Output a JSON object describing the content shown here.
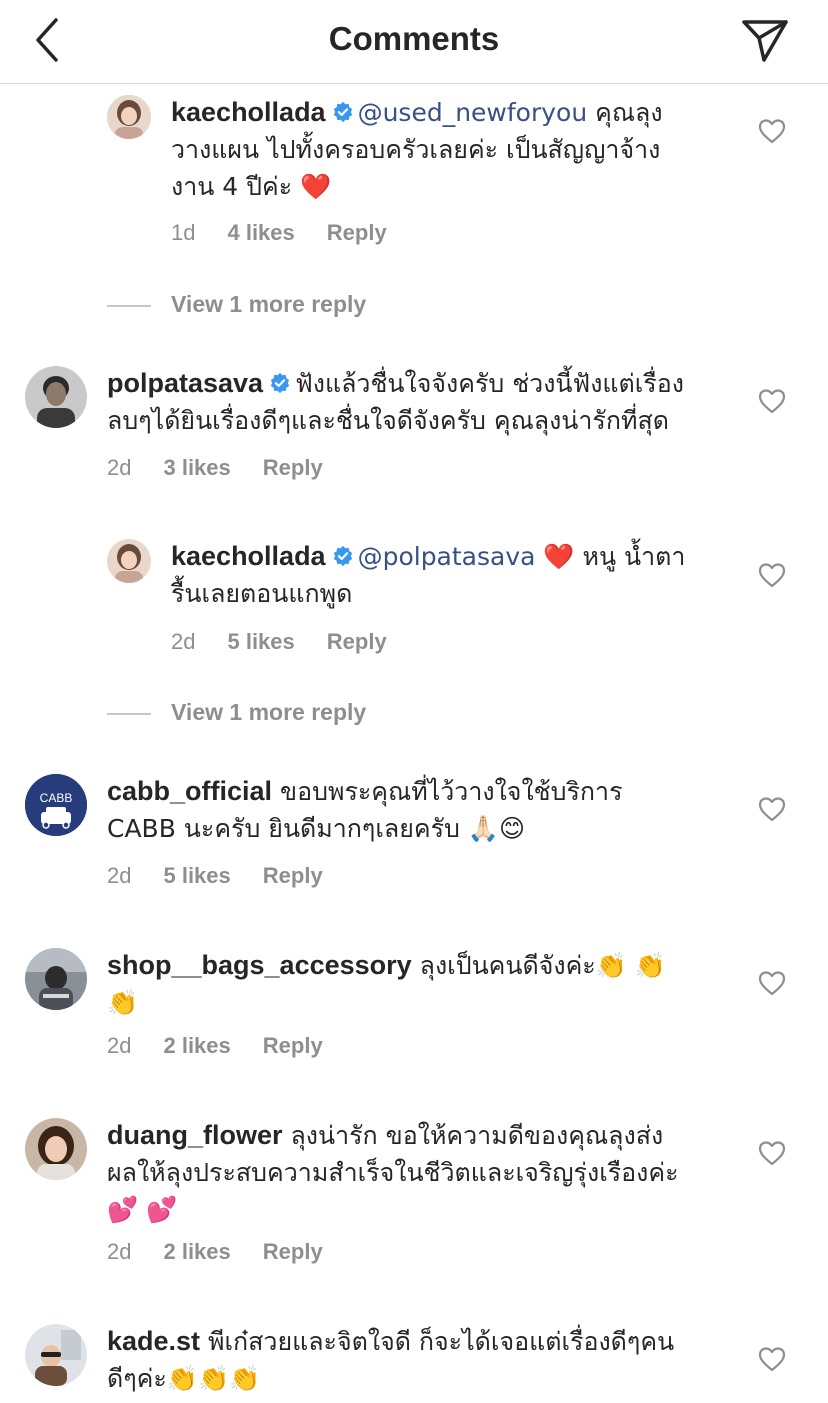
{
  "header": {
    "title": "Comments"
  },
  "comments": [
    {
      "username": "kaechollada",
      "mention": "@used_newforyou",
      "line1": " คุณลุง",
      "line2": "วางแผน ไปทั้งครอบครัวเลยค่ะ เป็นสัญญาจ้าง",
      "line3": "งาน 4 ปีค่ะ ",
      "emoji": "❤️",
      "time": "1d",
      "likes": "4 likes",
      "reply": "Reply"
    },
    {
      "username": "polpatasava",
      "line1": "ฟังแล้วชื่นใจจังครับ ช่วงนี้ฟังแต่เรื่อง",
      "line2": "ลบๆได้ยินเรื่องดีๆและชื่นใจดีจังครับ คุณลุงน่ารักที่สุด",
      "time": "2d",
      "likes": "3 likes",
      "reply": "Reply"
    },
    {
      "username": "kaechollada",
      "mention": "@polpatasava",
      "emoji": "❤️",
      "line1": " หนู น้ำตา",
      "line2": "รื้นเลยตอนแกพูด",
      "time": "2d",
      "likes": "5 likes",
      "reply": "Reply"
    },
    {
      "username": "cabb_official",
      "avatar_text": "CABB",
      "line1": " ขอบพระคุณที่ไว้วางใจใช้บริการ",
      "line2": "CABB นะครับ ยินดีมากๆเลยครับ ",
      "emoji": "🙏🏻😊",
      "time": "2d",
      "likes": "5 likes",
      "reply": "Reply"
    },
    {
      "username": "shop__bags_accessory",
      "line1": " ลุงเป็นคนดีจังค่ะ",
      "emoji1": "👏 👏",
      "emoji2": "👏",
      "time": "2d",
      "likes": "2 likes",
      "reply": "Reply"
    },
    {
      "username": "duang_flower",
      "line1": " ลุงน่ารัก ขอให้ความดีของคุณลุงส่ง",
      "line2": "ผลให้ลุงประสบความสำเร็จในชีวิตและเจริญรุ่งเรืองค่ะ",
      "emoji": "💕 💕",
      "time": "2d",
      "likes": "2 likes",
      "reply": "Reply"
    },
    {
      "username": "kade.st",
      "line1": " พีเก๋สวยและจิตใจดี ก็จะได้เจอแต่เรื่องดีๆคน",
      "line2": "ดีๆค่ะ",
      "emoji": "👏👏👏"
    }
  ],
  "view_more_1": "View 1 more reply",
  "view_more_2": "View 1 more reply",
  "icons": {
    "back": "chevron-left-icon",
    "share": "paper-plane-icon",
    "heart": "heart-outline-icon",
    "verified": "verified-badge-icon"
  },
  "colors": {
    "text": "#262626",
    "secondary": "#8e8e8e",
    "mention": "#385185",
    "verified": "#3897f0",
    "emoji_heart": "#e0245e"
  }
}
